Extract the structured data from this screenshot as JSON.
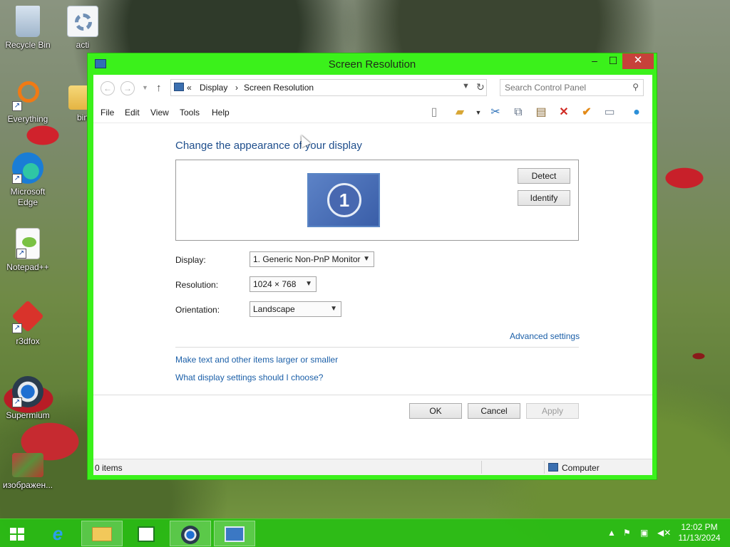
{
  "desktop": {
    "icons": [
      {
        "label": "Recycle Bin"
      },
      {
        "label": "acti"
      },
      {
        "label": "Everything"
      },
      {
        "label": "bin"
      },
      {
        "label": "Microsoft Edge"
      },
      {
        "label": "Notepad++"
      },
      {
        "label": "r3dfox"
      },
      {
        "label": "Supermium"
      },
      {
        "label": "изображен..."
      }
    ]
  },
  "window": {
    "title": "Screen Resolution",
    "controls": {
      "minimize": "–",
      "maximize": "☐",
      "close": "✕"
    },
    "address": {
      "crumbs": [
        "«",
        "Display",
        "›",
        "Screen Resolution"
      ]
    },
    "search": {
      "placeholder": "Search Control Panel"
    },
    "menu": [
      "File",
      "Edit",
      "View",
      "Tools",
      "Help"
    ],
    "heading": "Change the appearance of your display",
    "monitor_number": "1",
    "detect_label": "Detect",
    "identify_label": "Identify",
    "fields": {
      "display": {
        "label": "Display:",
        "value": "1. Generic Non-PnP Monitor"
      },
      "resolution": {
        "label": "Resolution:",
        "value": "1024 × 768"
      },
      "orientation": {
        "label": "Orientation:",
        "value": "Landscape"
      }
    },
    "links": {
      "advanced": "Advanced settings",
      "text_size": "Make text and other items larger or smaller",
      "which_settings": "What display settings should I choose?"
    },
    "buttons": {
      "ok": "OK",
      "cancel": "Cancel",
      "apply": "Apply"
    },
    "status": {
      "items": "0 items",
      "computer": "Computer"
    }
  },
  "taskbar": {
    "clock": {
      "time": "12:02 PM",
      "date": "11/13/2024"
    }
  },
  "colors": {
    "window_frame": "#3bf11b",
    "taskbar": "#28be14",
    "link": "#1b5fa8",
    "heading": "#1e4e8c"
  }
}
